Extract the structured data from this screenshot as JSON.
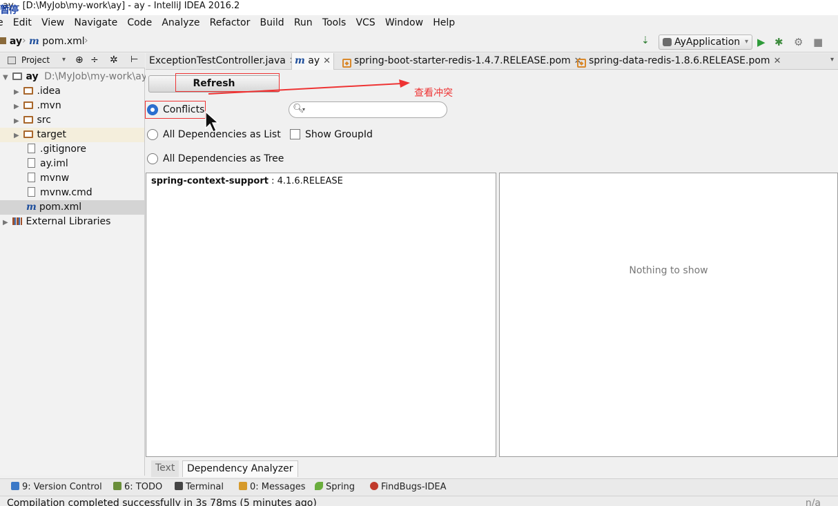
{
  "window": {
    "title": "ay - [D:\\MyJob\\my-work\\ay] - ay - IntelliJ IDEA 2016.2",
    "overlay_text": "暂停"
  },
  "menu": [
    "e",
    "Edit",
    "View",
    "Navigate",
    "Code",
    "Analyze",
    "Refactor",
    "Build",
    "Run",
    "Tools",
    "VCS",
    "Window",
    "Help"
  ],
  "breadcrumb": {
    "project": "ay",
    "file": "pom.xml"
  },
  "run_config": {
    "label": "AyApplication"
  },
  "project_panel": {
    "header_label": "Project",
    "root_name": "ay",
    "root_path": "D:\\MyJob\\my-work\\ay",
    "items": [
      {
        "label": ".idea",
        "kind": "folder"
      },
      {
        "label": ".mvn",
        "kind": "folder"
      },
      {
        "label": "src",
        "kind": "folder"
      },
      {
        "label": "target",
        "kind": "folder"
      },
      {
        "label": ".gitignore",
        "kind": "file"
      },
      {
        "label": "ay.iml",
        "kind": "file"
      },
      {
        "label": "mvnw",
        "kind": "file"
      },
      {
        "label": "mvnw.cmd",
        "kind": "file"
      },
      {
        "label": "pom.xml",
        "kind": "maven"
      }
    ],
    "external_libraries": "External Libraries"
  },
  "editor_tabs": [
    {
      "label": "ExceptionTestController.java"
    },
    {
      "label": "ay"
    },
    {
      "label": "spring-boot-starter-redis-1.4.7.RELEASE.pom"
    },
    {
      "label": "spring-data-redis-1.8.6.RELEASE.pom"
    }
  ],
  "analyzer": {
    "refresh_label": "Refresh",
    "options": [
      "Conflicts",
      "All Dependencies as List",
      "All Dependencies as Tree"
    ],
    "selected_option": "Conflicts",
    "show_group_id_label": "Show GroupId",
    "search_value": "",
    "conflicts": [
      {
        "artifact": "spring-context-support",
        "version": " : 4.1.6.RELEASE"
      }
    ],
    "detail_empty_text": "Nothing to show"
  },
  "annotation": {
    "text": "查看冲突",
    "color": "#e33333"
  },
  "bottom_tabs": [
    "Text",
    "Dependency Analyzer"
  ],
  "tool_windows": [
    {
      "label": "9: Version Control",
      "color": "#3b78c7"
    },
    {
      "label": "6: TODO",
      "color": "#6a8f3a"
    },
    {
      "label": "Terminal",
      "color": "#444444"
    },
    {
      "label": "0: Messages",
      "color": "#d69a2b"
    },
    {
      "label": "Spring",
      "color": "#6aad3d"
    },
    {
      "label": "FindBugs-IDEA",
      "color": "#c0392b"
    }
  ],
  "status": {
    "message": "Compilation completed successfully in 3s 78ms (5 minutes ago)",
    "right": "n/a"
  }
}
